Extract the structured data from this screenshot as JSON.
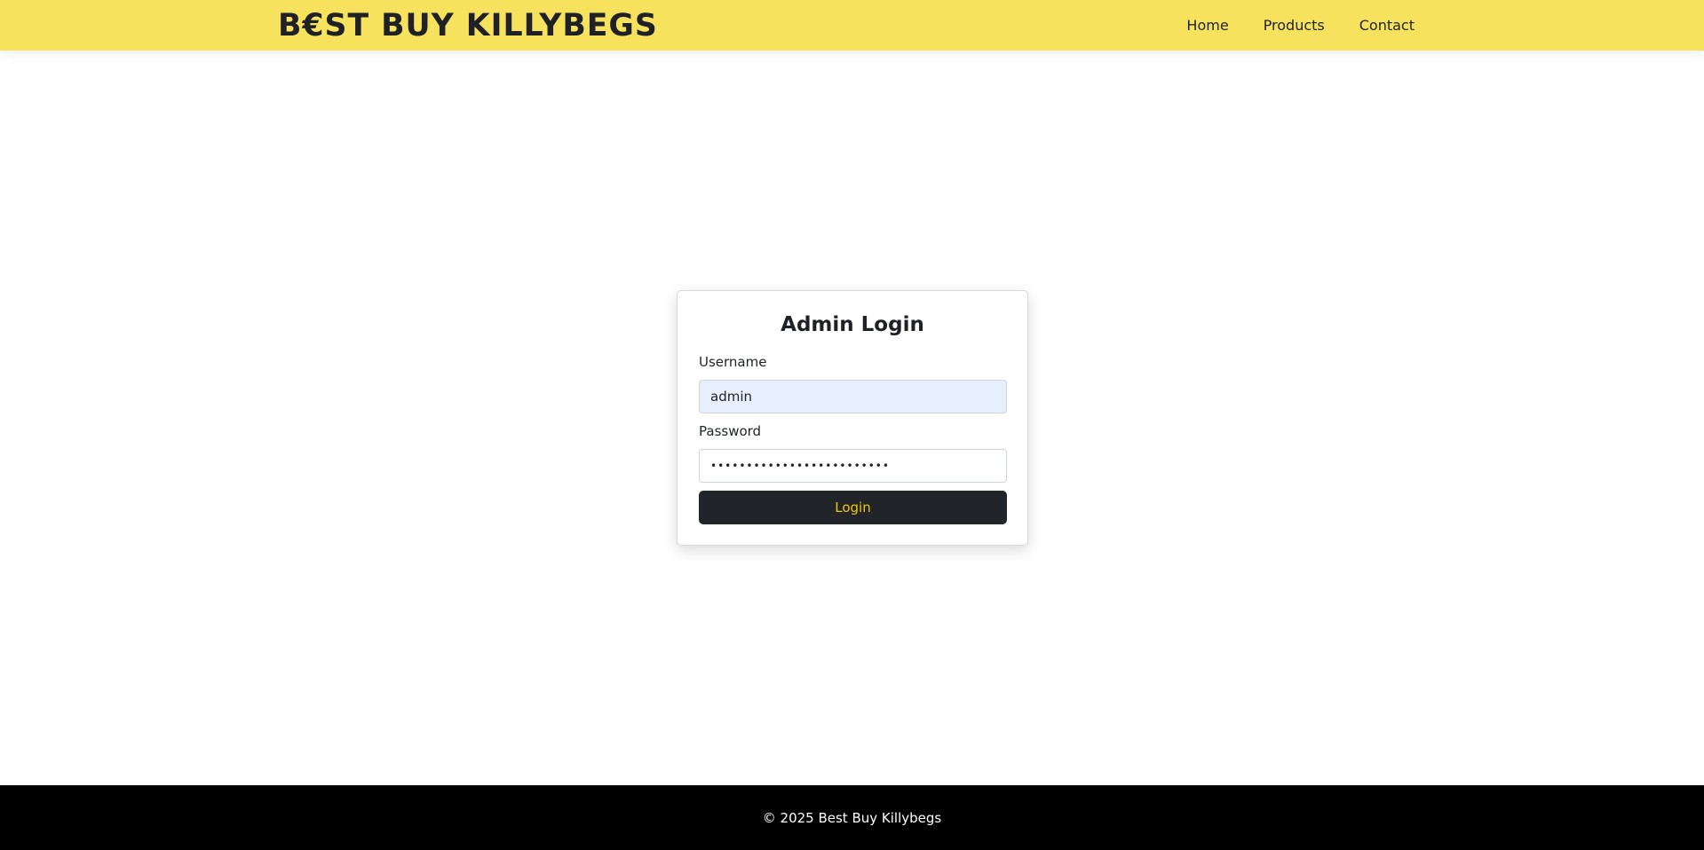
{
  "header": {
    "brand": "B€ST BUY KILLYBEGS",
    "nav": [
      {
        "label": "Home"
      },
      {
        "label": "Products"
      },
      {
        "label": "Contact"
      }
    ]
  },
  "login": {
    "title": "Admin Login",
    "username_label": "Username",
    "username_value": "admin",
    "password_label": "Password",
    "password_value": "•••••••••••••••••••••••••",
    "submit_label": "Login"
  },
  "footer": {
    "text": "© 2025 Best Buy Killybegs"
  },
  "colors": {
    "navbar_bg": "#f6e25c",
    "button_bg": "#212529",
    "button_text": "#f1c40f",
    "footer_bg": "#000000"
  }
}
